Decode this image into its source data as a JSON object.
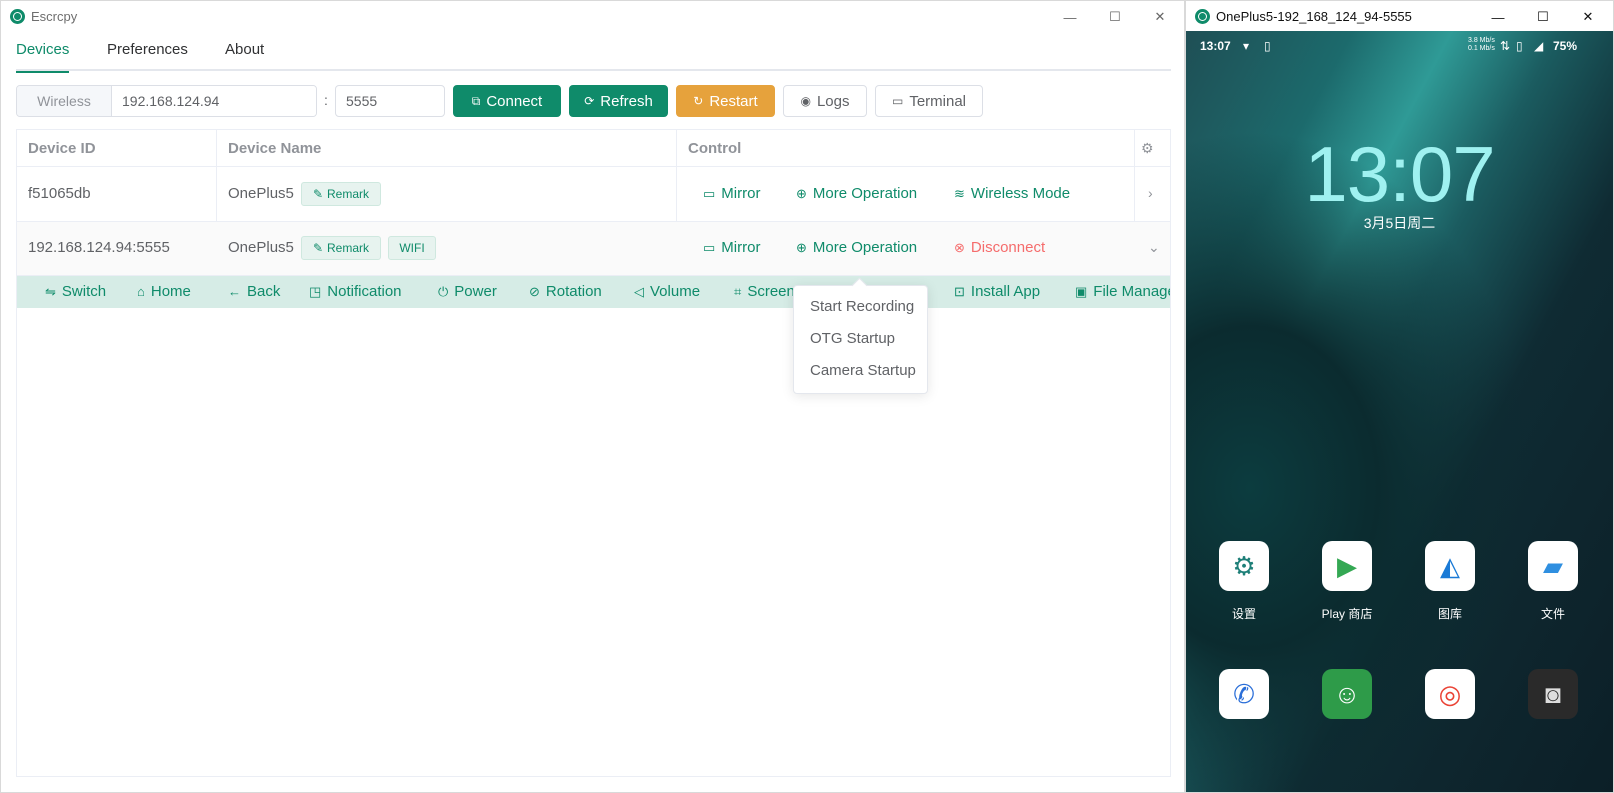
{
  "app": {
    "title": "Escrcpy",
    "window_controls": [
      "—",
      "☐",
      "✕"
    ]
  },
  "tabs": [
    {
      "label": "Devices",
      "active": true
    },
    {
      "label": "Preferences",
      "active": false
    },
    {
      "label": "About",
      "active": false
    }
  ],
  "toolbar": {
    "wireless_label": "Wireless",
    "ip_value": "192.168.124.94",
    "colon": ":",
    "port_value": "5555",
    "connect_label": "Connect",
    "refresh_label": "Refresh",
    "restart_label": "Restart",
    "logs_label": "Logs",
    "terminal_label": "Terminal"
  },
  "table": {
    "headers": {
      "device_id": "Device ID",
      "device_name": "Device Name",
      "control": "Control"
    },
    "rows": [
      {
        "id": "f51065db",
        "name": "OnePlus5",
        "remark": "Remark",
        "actions": [
          "Mirror",
          "More Operation",
          "Wireless Mode"
        ]
      },
      {
        "id": "192.168.124.94:5555",
        "name": "OnePlus5",
        "remark": "Remark",
        "wifi_tag": "WIFI",
        "actions": [
          "Mirror",
          "More Operation",
          "Disconnect"
        ]
      }
    ]
  },
  "control_bar": [
    "Switch",
    "Home",
    "Back",
    "Notification",
    "Power",
    "Rotation",
    "Volume",
    "Screenshot",
    "Install App",
    "File Manager"
  ],
  "dropdown": [
    "Start Recording",
    "OTG Startup",
    "Camera Startup"
  ],
  "phone": {
    "window_title": "OnePlus5-192_168_124_94-5555",
    "status_time": "13:07",
    "net_speed": "3.8 Mb/s\n0.1 Mb/s",
    "battery": "75%",
    "clock": "13:07",
    "date": "3月5日周二",
    "apps": [
      {
        "label": "设置",
        "icon": "settings-icon"
      },
      {
        "label": "Play 商店",
        "icon": "play-store-icon"
      },
      {
        "label": "图库",
        "icon": "gallery-icon"
      },
      {
        "label": "文件",
        "icon": "files-icon"
      },
      {
        "label": "",
        "icon": "phone-icon"
      },
      {
        "label": "",
        "icon": "messages-icon"
      },
      {
        "label": "",
        "icon": "chrome-icon"
      },
      {
        "label": "",
        "icon": "camera-icon"
      }
    ]
  },
  "colors": {
    "accent": "#0f8b6a",
    "warning": "#e6a23c",
    "danger": "#f56c6c"
  }
}
